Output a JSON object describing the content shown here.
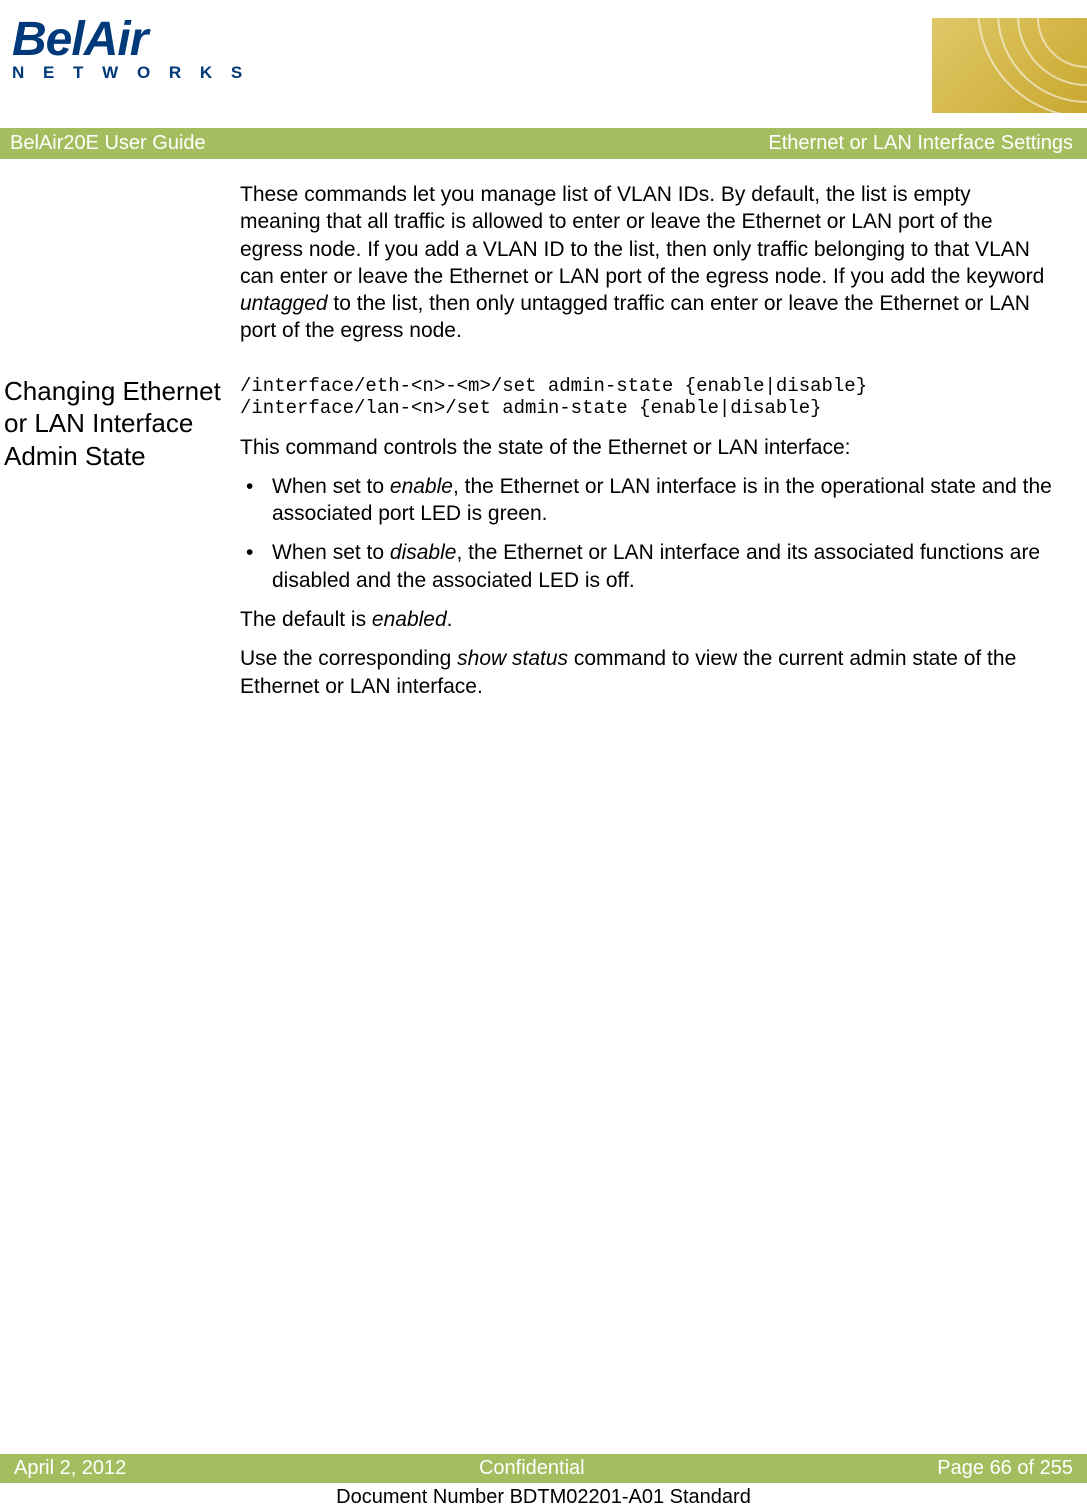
{
  "logo": {
    "line1": "BelAir",
    "line2": "N E T W O R K S"
  },
  "titleBar": {
    "left": "BelAir20E User Guide",
    "right": "Ethernet or LAN Interface Settings"
  },
  "intro": "These commands let you manage list of VLAN IDs. By default, the list is empty meaning that all traffic is allowed to enter or leave the Ethernet or LAN port of the egress node. If you add a VLAN ID to the list, then only traffic belonging to that VLAN can enter or leave the Ethernet or LAN port of the egress node. If you add the keyword ",
  "introItalic": "untagged",
  "introTail": " to the list, then only untagged traffic can enter or leave the Ethernet or LAN port of the egress node.",
  "section": {
    "heading": "Changing Ethernet or LAN Interface Admin State",
    "code": "/interface/eth-<n>-<m>/set admin-state {enable|disable}\n/interface/lan-<n>/set admin-state {enable|disable}",
    "p1": "This command controls the state of the Ethernet or LAN interface:",
    "b1a": "When set to ",
    "b1i": "enable",
    "b1b": ", the Ethernet or LAN interface is in the operational state and the associated port LED is green.",
    "b2a": "When set to ",
    "b2i": "disable",
    "b2b": ", the Ethernet or LAN interface and its associated functions are disabled and the associated LED is off.",
    "p2a": "The default is ",
    "p2i": "enabled",
    "p2b": ".",
    "p3a": "Use the corresponding ",
    "p3i": "show status",
    "p3b": " command to view the current admin state of the Ethernet or LAN interface."
  },
  "footer": {
    "left": "April 2, 2012",
    "center": "Confidential",
    "right": "Page 66 of 255"
  },
  "docNumber": "Document Number BDTM02201-A01 Standard"
}
